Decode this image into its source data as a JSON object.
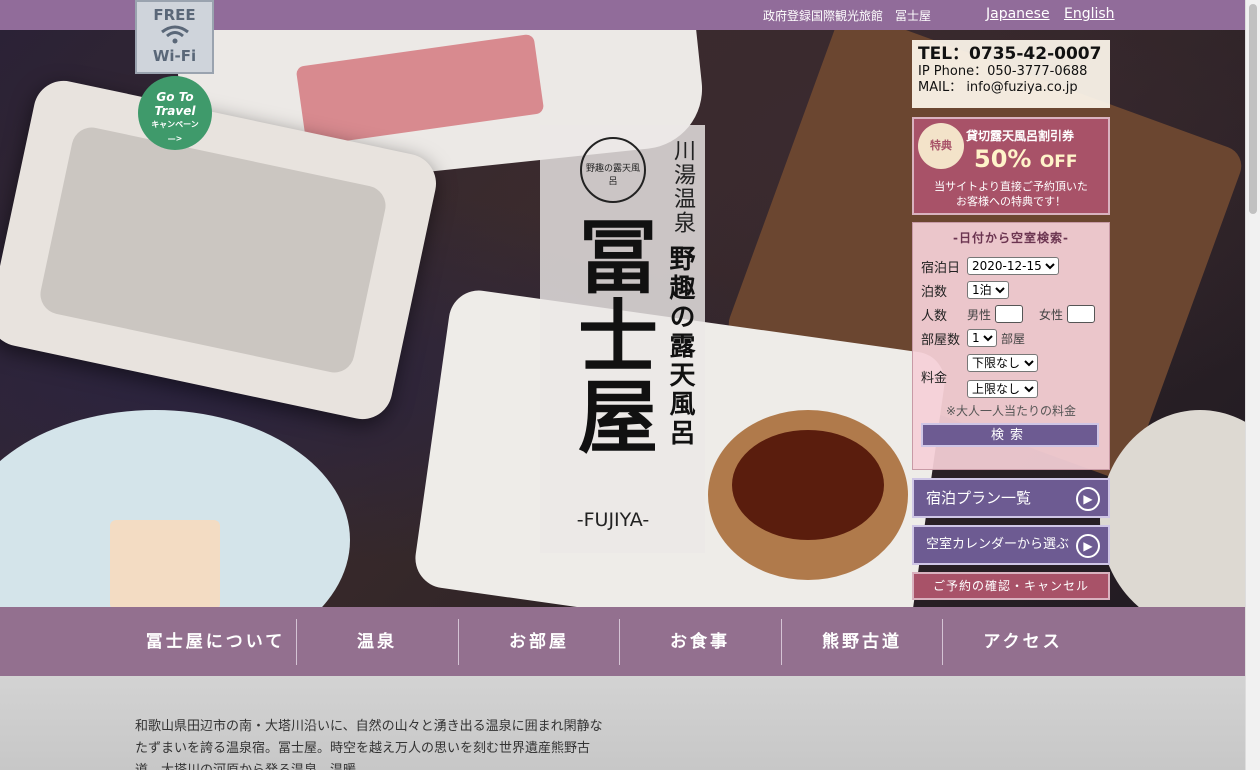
{
  "topbar": {
    "site_info": "政府登録国際観光旅館　冨士屋",
    "lang_ja": "Japanese",
    "lang_en": "English"
  },
  "badges": {
    "wifi_top": "FREE",
    "wifi_bottom": "Wi-Fi",
    "goto_line1": "Go To",
    "goto_line2": "Travel",
    "goto_line3": "キャンペーン",
    "goto_arrow": "—>"
  },
  "logo": {
    "emblem": "野趣の露天風呂",
    "vertical_1": "川湯温泉",
    "vertical_2": "野趣の露天風呂",
    "name": "冨士屋",
    "english": "-FUJIYA-"
  },
  "contact": {
    "tel": "TEL：0735-42-0007",
    "ip": "IP Phone：050-3777-0688",
    "mail": "MAIL： info@fuziya.co.jp"
  },
  "promo": {
    "badge": "特典",
    "title": "貸切露天風呂割引券",
    "percent": "50%",
    "off": "OFF",
    "note1": "当サイトより直接ご予約頂いた",
    "note2": "お客様への特典です！"
  },
  "search": {
    "heading": "-日付から空室検索-",
    "checkin_label": "宿泊日",
    "checkin_value": "2020-12-15",
    "nights_label": "泊数",
    "nights_value": "1泊",
    "people_label": "人数",
    "male_label": "男性",
    "female_label": "女性",
    "rooms_label": "部屋数",
    "rooms_value": "1",
    "rooms_unit": "部屋",
    "price_label": "料金",
    "price_min": "下限なし",
    "price_max": "上限なし",
    "price_note": "※大人一人当たりの料金",
    "submit": "検索"
  },
  "buttons": {
    "plans": "宿泊プラン一覧",
    "calendar": "空室カレンダーから選ぶ",
    "cancel": "ご予約の確認・キャンセル"
  },
  "nav": {
    "items": [
      "冨士屋について",
      "温泉",
      "お部屋",
      "お食事",
      "熊野古道",
      "アクセス"
    ]
  },
  "content": {
    "paragraph": "和歌山県田辺市の南・大塔川沿いに、自然の山々と湧き出る温泉に囲まれ閑静なたずまいを誇る温泉宿。冨士屋。時空を越え万人の思いを刻む世界遺産熊野古道、大塔川の河原から発る温泉、温暖"
  },
  "colors": {
    "brand_purple": "#93708f",
    "accent_rose": "#a85268",
    "button_violet": "#6d5b92"
  }
}
